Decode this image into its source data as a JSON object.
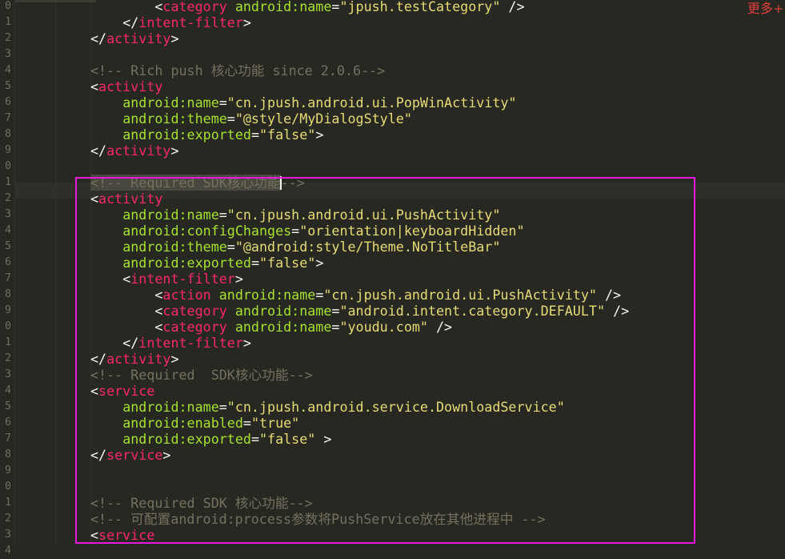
{
  "watermark": "更多+",
  "gutter": [
    "0",
    "1",
    "2",
    "3",
    "4",
    "5",
    "6",
    "7",
    "8",
    "9",
    "0",
    "1",
    "2",
    "3",
    "4",
    "5",
    "6",
    "7",
    "8",
    "9",
    "0",
    "1",
    "2",
    "3",
    "4",
    "5",
    "6",
    "7",
    "8",
    "9",
    "0",
    "1",
    "2",
    "3",
    "4"
  ],
  "code": [
    [
      [
        "p",
        "        "
      ],
      [
        "p",
        "<"
      ],
      [
        "t",
        "category"
      ],
      [
        "p",
        " "
      ],
      [
        "a",
        "android:name"
      ],
      [
        "p",
        "="
      ],
      [
        "s",
        "\"jpush.testCategory\""
      ],
      [
        "p",
        " />"
      ]
    ],
    [
      [
        "p",
        "    "
      ],
      [
        "p",
        "</"
      ],
      [
        "t",
        "intent-filter"
      ],
      [
        "p",
        ">"
      ]
    ],
    [
      [
        "p",
        "</"
      ],
      [
        "t",
        "activity"
      ],
      [
        "p",
        ">"
      ]
    ],
    [],
    [
      [
        "c",
        "<!-- Rich push 核心功能 since 2.0.6-->"
      ]
    ],
    [
      [
        "p",
        "<"
      ],
      [
        "t",
        "activity"
      ]
    ],
    [
      [
        "p",
        "    "
      ],
      [
        "a",
        "android:name"
      ],
      [
        "p",
        "="
      ],
      [
        "s",
        "\"cn.jpush.android.ui.PopWinActivity\""
      ]
    ],
    [
      [
        "p",
        "    "
      ],
      [
        "a",
        "android:theme"
      ],
      [
        "p",
        "="
      ],
      [
        "s",
        "\"@style/MyDialogStyle\""
      ]
    ],
    [
      [
        "p",
        "    "
      ],
      [
        "a",
        "android:exported"
      ],
      [
        "p",
        "="
      ],
      [
        "s",
        "\"false\""
      ],
      [
        "p",
        ">"
      ]
    ],
    [
      [
        "p",
        "</"
      ],
      [
        "t",
        "activity"
      ],
      [
        "p",
        ">"
      ]
    ],
    [],
    [
      [
        "c",
        "<!-- Required SDK核心功能"
      ],
      [
        "c",
        "-->"
      ]
    ],
    [
      [
        "p",
        "<"
      ],
      [
        "t",
        "activity"
      ]
    ],
    [
      [
        "p",
        "    "
      ],
      [
        "a",
        "android:name"
      ],
      [
        "p",
        "="
      ],
      [
        "s",
        "\"cn.jpush.android.ui.PushActivity\""
      ]
    ],
    [
      [
        "p",
        "    "
      ],
      [
        "a",
        "android:configChanges"
      ],
      [
        "p",
        "="
      ],
      [
        "s",
        "\"orientation|keyboardHidden\""
      ]
    ],
    [
      [
        "p",
        "    "
      ],
      [
        "a",
        "android:theme"
      ],
      [
        "p",
        "="
      ],
      [
        "s",
        "\"@android:style/Theme.NoTitleBar\""
      ]
    ],
    [
      [
        "p",
        "    "
      ],
      [
        "a",
        "android:exported"
      ],
      [
        "p",
        "="
      ],
      [
        "s",
        "\"false\""
      ],
      [
        "p",
        ">"
      ]
    ],
    [
      [
        "p",
        "    "
      ],
      [
        "p",
        "<"
      ],
      [
        "t",
        "intent-filter"
      ],
      [
        "p",
        ">"
      ]
    ],
    [
      [
        "p",
        "        "
      ],
      [
        "p",
        "<"
      ],
      [
        "t",
        "action"
      ],
      [
        "p",
        " "
      ],
      [
        "a",
        "android:name"
      ],
      [
        "p",
        "="
      ],
      [
        "s",
        "\"cn.jpush.android.ui.PushActivity\""
      ],
      [
        "p",
        " />"
      ]
    ],
    [
      [
        "p",
        "        "
      ],
      [
        "p",
        "<"
      ],
      [
        "t",
        "category"
      ],
      [
        "p",
        " "
      ],
      [
        "a",
        "android:name"
      ],
      [
        "p",
        "="
      ],
      [
        "s",
        "\"android.intent.category.DEFAULT\""
      ],
      [
        "p",
        " />"
      ]
    ],
    [
      [
        "p",
        "        "
      ],
      [
        "p",
        "<"
      ],
      [
        "t",
        "category"
      ],
      [
        "p",
        " "
      ],
      [
        "a",
        "android:name"
      ],
      [
        "p",
        "="
      ],
      [
        "s",
        "\"youdu.com\""
      ],
      [
        "p",
        " />"
      ]
    ],
    [
      [
        "p",
        "    "
      ],
      [
        "p",
        "</"
      ],
      [
        "t",
        "intent-filter"
      ],
      [
        "p",
        ">"
      ]
    ],
    [
      [
        "p",
        "</"
      ],
      [
        "t",
        "activity"
      ],
      [
        "p",
        ">"
      ]
    ],
    [
      [
        "c",
        "<!-- Required  SDK核心功能-->"
      ]
    ],
    [
      [
        "p",
        "<"
      ],
      [
        "t",
        "service"
      ]
    ],
    [
      [
        "p",
        "    "
      ],
      [
        "a",
        "android:name"
      ],
      [
        "p",
        "="
      ],
      [
        "s",
        "\"cn.jpush.android.service.DownloadService\""
      ]
    ],
    [
      [
        "p",
        "    "
      ],
      [
        "a",
        "android:enabled"
      ],
      [
        "p",
        "="
      ],
      [
        "s",
        "\"true\""
      ]
    ],
    [
      [
        "p",
        "    "
      ],
      [
        "a",
        "android:exported"
      ],
      [
        "p",
        "="
      ],
      [
        "s",
        "\"false\""
      ],
      [
        "p",
        " >"
      ]
    ],
    [
      [
        "p",
        "</"
      ],
      [
        "t",
        "service"
      ],
      [
        "p",
        ">"
      ]
    ],
    [],
    [],
    [
      [
        "c",
        "<!-- Required SDK 核心功能-->"
      ]
    ],
    [
      [
        "c",
        "<!-- 可配置android:process参数将PushService放在其他进程中 -->"
      ]
    ],
    [
      [
        "p",
        "<"
      ],
      [
        "t",
        "service"
      ]
    ],
    []
  ]
}
